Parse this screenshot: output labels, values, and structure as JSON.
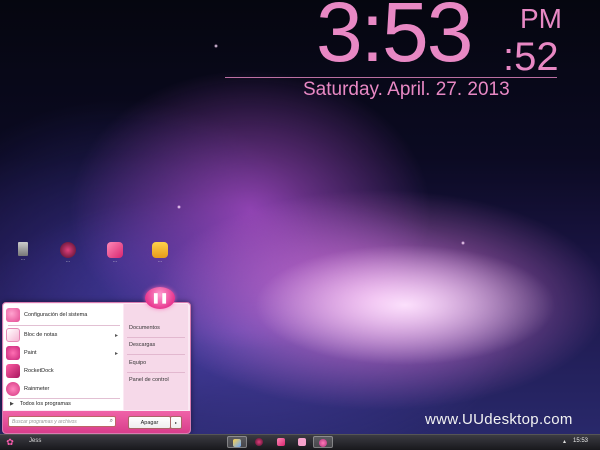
{
  "clock": {
    "time": "3:53",
    "ampm": "PM",
    "seconds": ":52",
    "date": "Saturday. April. 27. 2013"
  },
  "watermark": "www.UUdesktop.com",
  "desktop_icons": [
    {
      "icon": "recycle-bin-icon",
      "label": "..."
    },
    {
      "icon": "media-player-icon",
      "label": "..."
    },
    {
      "icon": "music-icon",
      "label": "..."
    },
    {
      "icon": "cake-icon",
      "label": "..."
    }
  ],
  "start_menu": {
    "left_items": [
      {
        "label": "Configuración del sistema",
        "icon": "heart-icon",
        "submenu": false
      },
      {
        "label": "Bloc de notas",
        "icon": "notepad-icon",
        "submenu": true
      },
      {
        "label": "Paint",
        "icon": "paint-icon",
        "submenu": true
      },
      {
        "label": "RocketDock",
        "icon": "rocketdock-icon",
        "submenu": false
      },
      {
        "label": "Rainmeter",
        "icon": "rainmeter-icon",
        "submenu": false
      }
    ],
    "all_programs": "Todos los programas",
    "right_items": [
      "Documentos",
      "Descargas",
      "Equipo",
      "Panel de control"
    ],
    "search_placeholder": "Buscar programas y archivos",
    "shutdown_label": "Apagar"
  },
  "taskbar": {
    "user": "Jess",
    "clock": "15:53",
    "apps": [
      "explorer-icon",
      "media-icon",
      "music-icon",
      "paint-icon",
      "player-icon"
    ]
  },
  "colors": {
    "accent": "#e888c4",
    "start_bottom": "#e8509a",
    "taskbar": "#202024"
  }
}
